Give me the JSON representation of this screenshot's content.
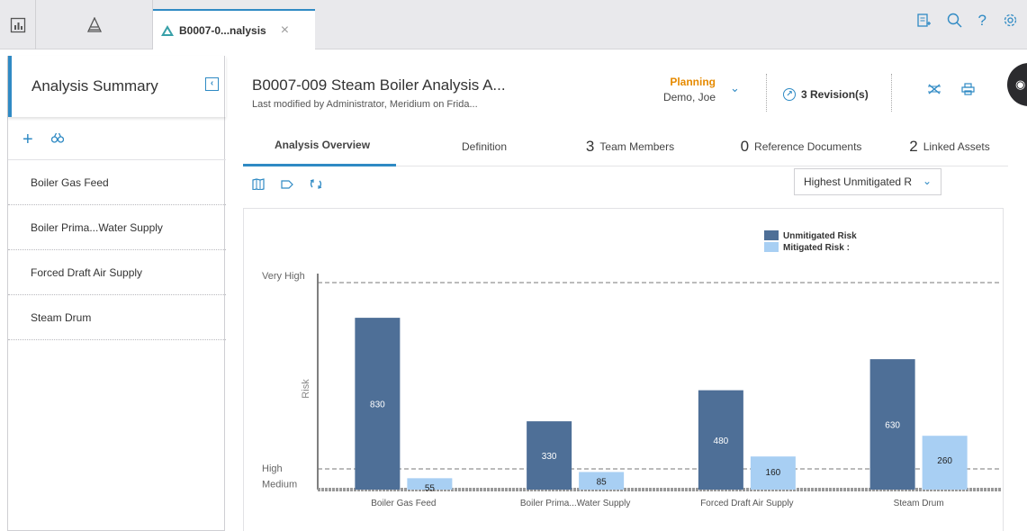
{
  "topbar": {
    "tabs": [
      {
        "icon": "dashboard-icon"
      },
      {
        "icon": "asset-hierarchy-icon"
      }
    ],
    "document_tab": {
      "label": "B0007-0...nalysis",
      "close": "×",
      "icon": "rca-triangle-icon"
    },
    "right_icons": [
      "clipboard-add-icon",
      "search-icon",
      "help-icon",
      "gear-icon"
    ]
  },
  "sidebar": {
    "title": "Analysis Summary",
    "collapse_icon": "collapse-icon",
    "tools": [
      "add-icon",
      "find-icon"
    ],
    "items": [
      {
        "label": "Boiler Gas Feed"
      },
      {
        "label": "Boiler Prima...Water Supply"
      },
      {
        "label": "Forced Draft Air Supply"
      },
      {
        "label": "Steam Drum"
      }
    ]
  },
  "header": {
    "title": "B0007-009 Steam Boiler Analysis A...",
    "subtitle": "Last modified by Administrator, Meridium on Frida...",
    "state": "Planning",
    "state_user": "Demo, Joe",
    "revisions": "3 Revision(s)",
    "icons": [
      "analysis-tree-icon",
      "print-icon"
    ],
    "state_color": "#e68a00",
    "accent_color": "#2f8ac4"
  },
  "tabs": [
    {
      "num": "",
      "label": "Analysis Overview"
    },
    {
      "num": "",
      "label": "Definition"
    },
    {
      "num": "3",
      "label": "Team Members"
    },
    {
      "num": "0",
      "label": "Reference Documents"
    },
    {
      "num": "2",
      "label": "Linked Assets"
    }
  ],
  "toolbar": {
    "icons": [
      "map-icon",
      "tag-icon",
      "refresh-icon"
    ],
    "sort_value": "Highest Unmitigated R"
  },
  "chart_data": {
    "type": "bar",
    "ylabel": "Risk",
    "xlabel": "",
    "categories": [
      "Boiler Gas Feed",
      "Boiler Prima...Water Supply",
      "Forced Draft Air Supply",
      "Steam Drum"
    ],
    "series": [
      {
        "name": "Unmitigated Risk",
        "values": [
          830,
          330,
          480,
          630
        ],
        "color": "#4e6f97"
      },
      {
        "name": "Mitigated Risk :",
        "values": [
          55,
          85,
          160,
          260
        ],
        "color": "#a8cff3"
      }
    ],
    "ylim": [
      0,
      1000
    ],
    "thresholds": [
      {
        "label": "Very High",
        "value": 1000
      },
      {
        "label": "High",
        "value": 100
      },
      {
        "label": "Medium",
        "value": 25
      }
    ],
    "legend_position": "top-right"
  }
}
